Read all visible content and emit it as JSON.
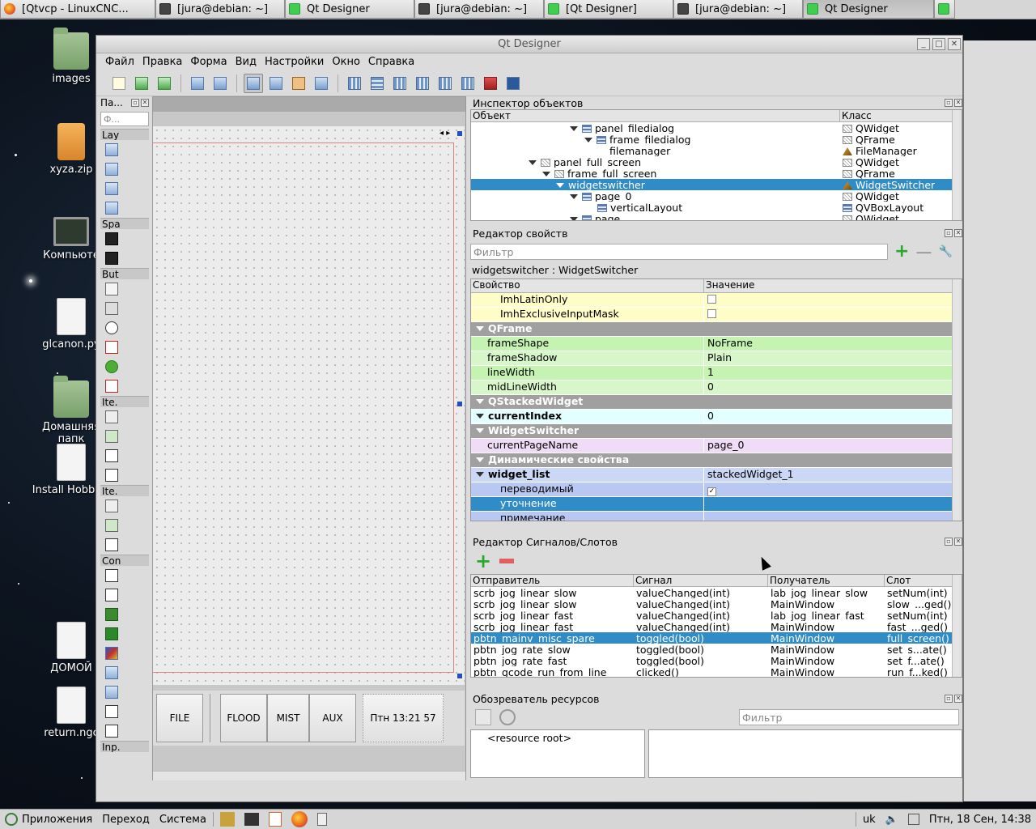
{
  "top_tasks": [
    {
      "label": "[Qtvcp - LinuxCNC...",
      "icon": "firefox-icon"
    },
    {
      "label": "[jura@debian: ~]",
      "icon": "terminal-icon"
    },
    {
      "label": "Qt Designer",
      "icon": "qt-icon"
    },
    {
      "label": "[jura@debian: ~]",
      "icon": "terminal-icon"
    },
    {
      "label": "[Qt Designer]",
      "icon": "qt-icon"
    },
    {
      "label": "[jura@debian: ~]",
      "icon": "terminal-icon"
    },
    {
      "label": "Qt Designer",
      "icon": "qt-icon"
    }
  ],
  "desktop_icons": [
    "images",
    "xyza.zip",
    "Компьюте",
    "glcanon.py",
    "Домашняя папк",
    "Install HobbyM",
    "ДОМОЙ",
    "return.ngc"
  ],
  "window": {
    "title": "Qt Designer"
  },
  "menu": [
    "Файл",
    "Правка",
    "Форма",
    "Вид",
    "Настройки",
    "Окно",
    "Справка"
  ],
  "widget_box": {
    "title": "Па...",
    "filter_placeholder": "Ф...",
    "categories": [
      "Lay",
      "Spa",
      "But",
      "Ite.",
      "Ite.",
      "Con",
      "Inp."
    ]
  },
  "form": {
    "buttons": [
      "FILE",
      "FLOOD",
      "MIST",
      "AUX"
    ],
    "clock": "Птн 13:21 57"
  },
  "object_inspector": {
    "title": "Инспектор объектов",
    "col_object": "Объект",
    "col_class": "Класс",
    "rows": [
      {
        "name": "panel_filedialog",
        "class": "QWidget",
        "expanded": true
      },
      {
        "name": "frame_filedialog",
        "class": "QFrame",
        "expanded": true
      },
      {
        "name": "filemanager",
        "class": "FileManager",
        "expanded": false
      },
      {
        "name": "panel_full_screen",
        "class": "QWidget",
        "expanded": true
      },
      {
        "name": "frame_full_screen",
        "class": "QFrame",
        "expanded": true
      },
      {
        "name": "widgetswitcher",
        "class": "WidgetSwitcher",
        "expanded": true,
        "selected": true
      },
      {
        "name": "page_0",
        "class": "QWidget",
        "expanded": true
      },
      {
        "name": "verticalLayout",
        "class": "QVBoxLayout",
        "expanded": false
      },
      {
        "name": "page",
        "class": "QWidget",
        "expanded": true
      }
    ]
  },
  "property_editor": {
    "title": "Редактор свойств",
    "filter_placeholder": "Фильтр",
    "object_label": "widgetswitcher : WidgetSwitcher",
    "col_property": "Свойство",
    "col_value": "Значение",
    "rows": [
      {
        "type": "prop",
        "name": "ImhLatinOnly",
        "value": "",
        "check": "unchecked",
        "color": "#fefdc8"
      },
      {
        "type": "prop",
        "name": "ImhExclusiveInputMask",
        "value": "",
        "check": "unchecked",
        "color": "#fefdc8"
      },
      {
        "type": "group",
        "name": "QFrame"
      },
      {
        "type": "prop",
        "name": "frameShape",
        "value": "NoFrame",
        "color": "#c4f3b2"
      },
      {
        "type": "prop",
        "name": "frameShadow",
        "value": "Plain",
        "color": "#d7f6ca"
      },
      {
        "type": "prop",
        "name": "lineWidth",
        "value": "1",
        "color": "#c4f3b2"
      },
      {
        "type": "prop",
        "name": "midLineWidth",
        "value": "0",
        "color": "#d7f6ca"
      },
      {
        "type": "group",
        "name": "QStackedWidget"
      },
      {
        "type": "prop",
        "name": "currentIndex",
        "value": "0",
        "color": "#e3ffff",
        "bold": true
      },
      {
        "type": "group",
        "name": "WidgetSwitcher"
      },
      {
        "type": "prop",
        "name": "currentPageName",
        "value": "page_0",
        "color": "#f1dcf7"
      },
      {
        "type": "group",
        "name": "Динамические свойства"
      },
      {
        "type": "prop",
        "name": "widget_list",
        "value": "stackedWidget_1",
        "color": "#cad7f5",
        "bold": true
      },
      {
        "type": "prop",
        "name": "переводимый",
        "value": "",
        "check": "checked",
        "color": "#b9c8f3"
      },
      {
        "type": "prop",
        "name": "уточнение",
        "value": "",
        "color": "#308cc6",
        "selected": true
      },
      {
        "type": "prop",
        "name": "примечание",
        "value": "",
        "color": "#b9c8f3"
      }
    ]
  },
  "signal_slot_editor": {
    "title": "Редактор Сигналов/Слотов",
    "headers": [
      "Отправитель",
      "Сигнал",
      "Получатель",
      "Слот"
    ],
    "rows": [
      [
        "scrb_jog_linear_slow",
        "valueChanged(int)",
        "lab_jog_linear_slow",
        "setNum(int)"
      ],
      [
        "scrb_jog_linear_slow",
        "valueChanged(int)",
        "MainWindow",
        "slow_...ged()"
      ],
      [
        "scrb_jog_linear_fast",
        "valueChanged(int)",
        "lab_jog_linear_fast",
        "setNum(int)"
      ],
      [
        "scrb_jog_linear_fast",
        "valueChanged(int)",
        "MainWindow",
        "fast_...ged()"
      ],
      [
        "pbtn_mainv_misc_spare",
        "toggled(bool)",
        "MainWindow",
        "full_screen()"
      ],
      [
        "pbtn_jog_rate_slow",
        "toggled(bool)",
        "MainWindow",
        "set_s...ate()"
      ],
      [
        "pbtn_jog_rate_fast",
        "toggled(bool)",
        "MainWindow",
        "set_f...ate()"
      ],
      [
        "pbtn_gcode_run_from_line",
        "clicked()",
        "MainWindow",
        "run_f...ked()"
      ]
    ],
    "selected_row": 4
  },
  "resource_browser": {
    "title": "Обозреватель ресурсов",
    "filter_placeholder": "Фильтр",
    "root": "<resource root>"
  },
  "bottom_panel": {
    "apps": "Приложения",
    "places": "Переход",
    "system": "Система",
    "kbd": "uk",
    "clock": "Птн, 18 Сен, 14:38"
  }
}
